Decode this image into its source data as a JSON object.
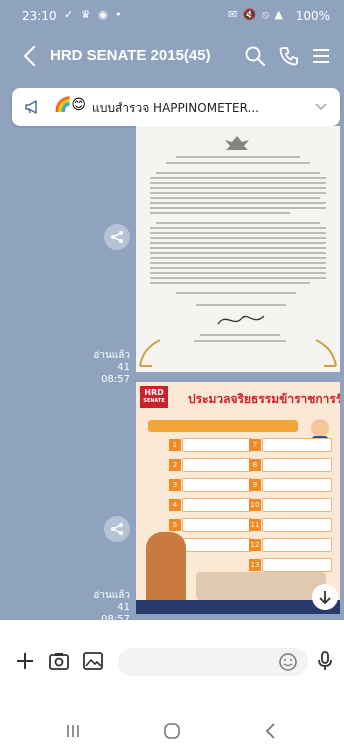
{
  "status_bar": {
    "time": "23:10",
    "left_icons": "✓ ♛ ◉ •",
    "right_icons": "✉ 🔇 ⦸ ▲",
    "battery": "100%"
  },
  "header": {
    "title": "HRD SENATE 2015(45)",
    "icons": [
      "back-icon",
      "search-icon",
      "phone-icon",
      "menu-icon"
    ]
  },
  "announcement": {
    "emoji": "🌈😊",
    "text": "แบบสำรวจ HAPPINOMETER..."
  },
  "messages": [
    {
      "type": "image",
      "read_label": "อ่านแล้ว 41",
      "time": "08:57",
      "description_kind": "document"
    },
    {
      "type": "image",
      "read_label": "อ่านแล้ว 41",
      "time": "08:57",
      "poster_badge": "HRD",
      "poster_badge_sub": "SENATE",
      "poster_title": "ประมวลจริยธรรมข้าราชการรัฐสภา"
    }
  ],
  "input": {
    "placeholder": ""
  },
  "colors": {
    "chat_bg": "#8fa3bf",
    "poster_red": "#d21e2a",
    "poster_orange": "#f08a24"
  }
}
